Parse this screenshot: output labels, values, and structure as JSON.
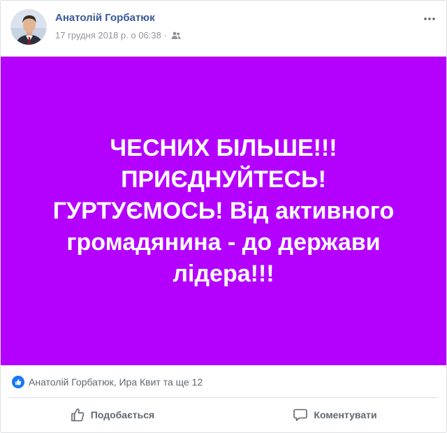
{
  "post": {
    "author": "Анатолій Горбатюк",
    "timestamp": "17 грудня 2018 р. о 06:38",
    "separator": "·",
    "audience_icon": "friends-icon",
    "menu_icon": "more-options-icon",
    "image_text": "ЧЕСНИХ БІЛЬШЕ!!!\nПРИЄДНУЙТЕСЬ!\nГУРТУЄМОСЬ! Від активного\nгромадянина - до держави\nлідера!!!",
    "image_background": "#b400ff"
  },
  "reactions": {
    "icon": "like-reaction-icon",
    "text": "Анатолій Горбатюк, Ира Квит та ще 12"
  },
  "actions": {
    "like_label": "Подобається",
    "comment_label": "Коментувати"
  },
  "colors": {
    "link": "#385898",
    "meta": "#90949c",
    "action": "#606770",
    "like_blue": "#1877f2"
  }
}
